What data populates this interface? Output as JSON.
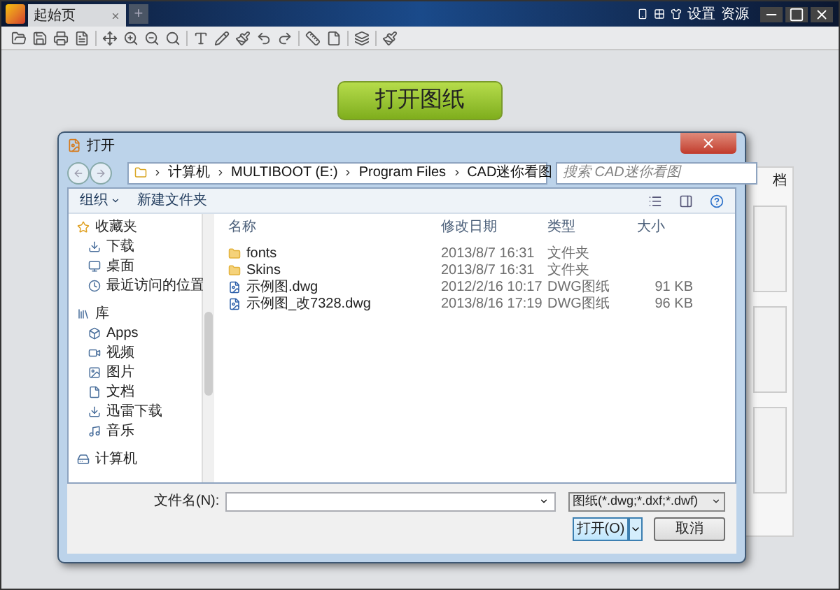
{
  "app": {
    "tab": "起始页",
    "tab_add": "+",
    "top_links": [
      "设置",
      "资源"
    ],
    "open_button": "打开图纸",
    "side_heading": "档"
  },
  "dialog": {
    "title": "打开",
    "breadcrumb": [
      "计算机",
      "MULTIBOOT (E:)",
      "Program Files",
      "CAD迷你看图"
    ],
    "search": {
      "placeholder": "搜索 CAD迷你看图"
    },
    "toolbar": {
      "organize": "组织",
      "new_folder": "新建文件夹"
    },
    "sidebar": [
      {
        "label": "收藏夹",
        "kind": "star",
        "children": [
          {
            "label": "下载",
            "kind": "download"
          },
          {
            "label": "桌面",
            "kind": "desktop"
          },
          {
            "label": "最近访问的位置",
            "kind": "recent"
          }
        ]
      },
      {
        "label": "库",
        "kind": "library",
        "children": [
          {
            "label": "Apps",
            "kind": "apps"
          },
          {
            "label": "视频",
            "kind": "video"
          },
          {
            "label": "图片",
            "kind": "image"
          },
          {
            "label": "文档",
            "kind": "doc"
          },
          {
            "label": "迅雷下载",
            "kind": "download"
          },
          {
            "label": "音乐",
            "kind": "music"
          }
        ]
      },
      {
        "label": "计算机",
        "kind": "computer"
      }
    ],
    "columns": [
      "名称",
      "修改日期",
      "类型",
      "大小"
    ],
    "files": [
      {
        "kind": "folder",
        "name": "fonts",
        "date": "2013/8/7 16:31",
        "type": "文件夹"
      },
      {
        "kind": "folder",
        "name": "Skins",
        "date": "2013/8/7 16:31",
        "type": "文件夹"
      },
      {
        "kind": "dwg",
        "name": "示例图.dwg",
        "date": "2012/2/16 10:17",
        "type": "DWG图纸",
        "size": "91 KB"
      },
      {
        "kind": "dwg",
        "name": "示例图_改7328.dwg",
        "date": "2013/8/16 17:19",
        "type": "DWG图纸",
        "size": "96 KB"
      }
    ],
    "filename_label": "文件名(N):",
    "filter": "图纸(*.dwg;*.dxf;*.dwf)",
    "open": "打开(O)",
    "cancel": "取消"
  }
}
